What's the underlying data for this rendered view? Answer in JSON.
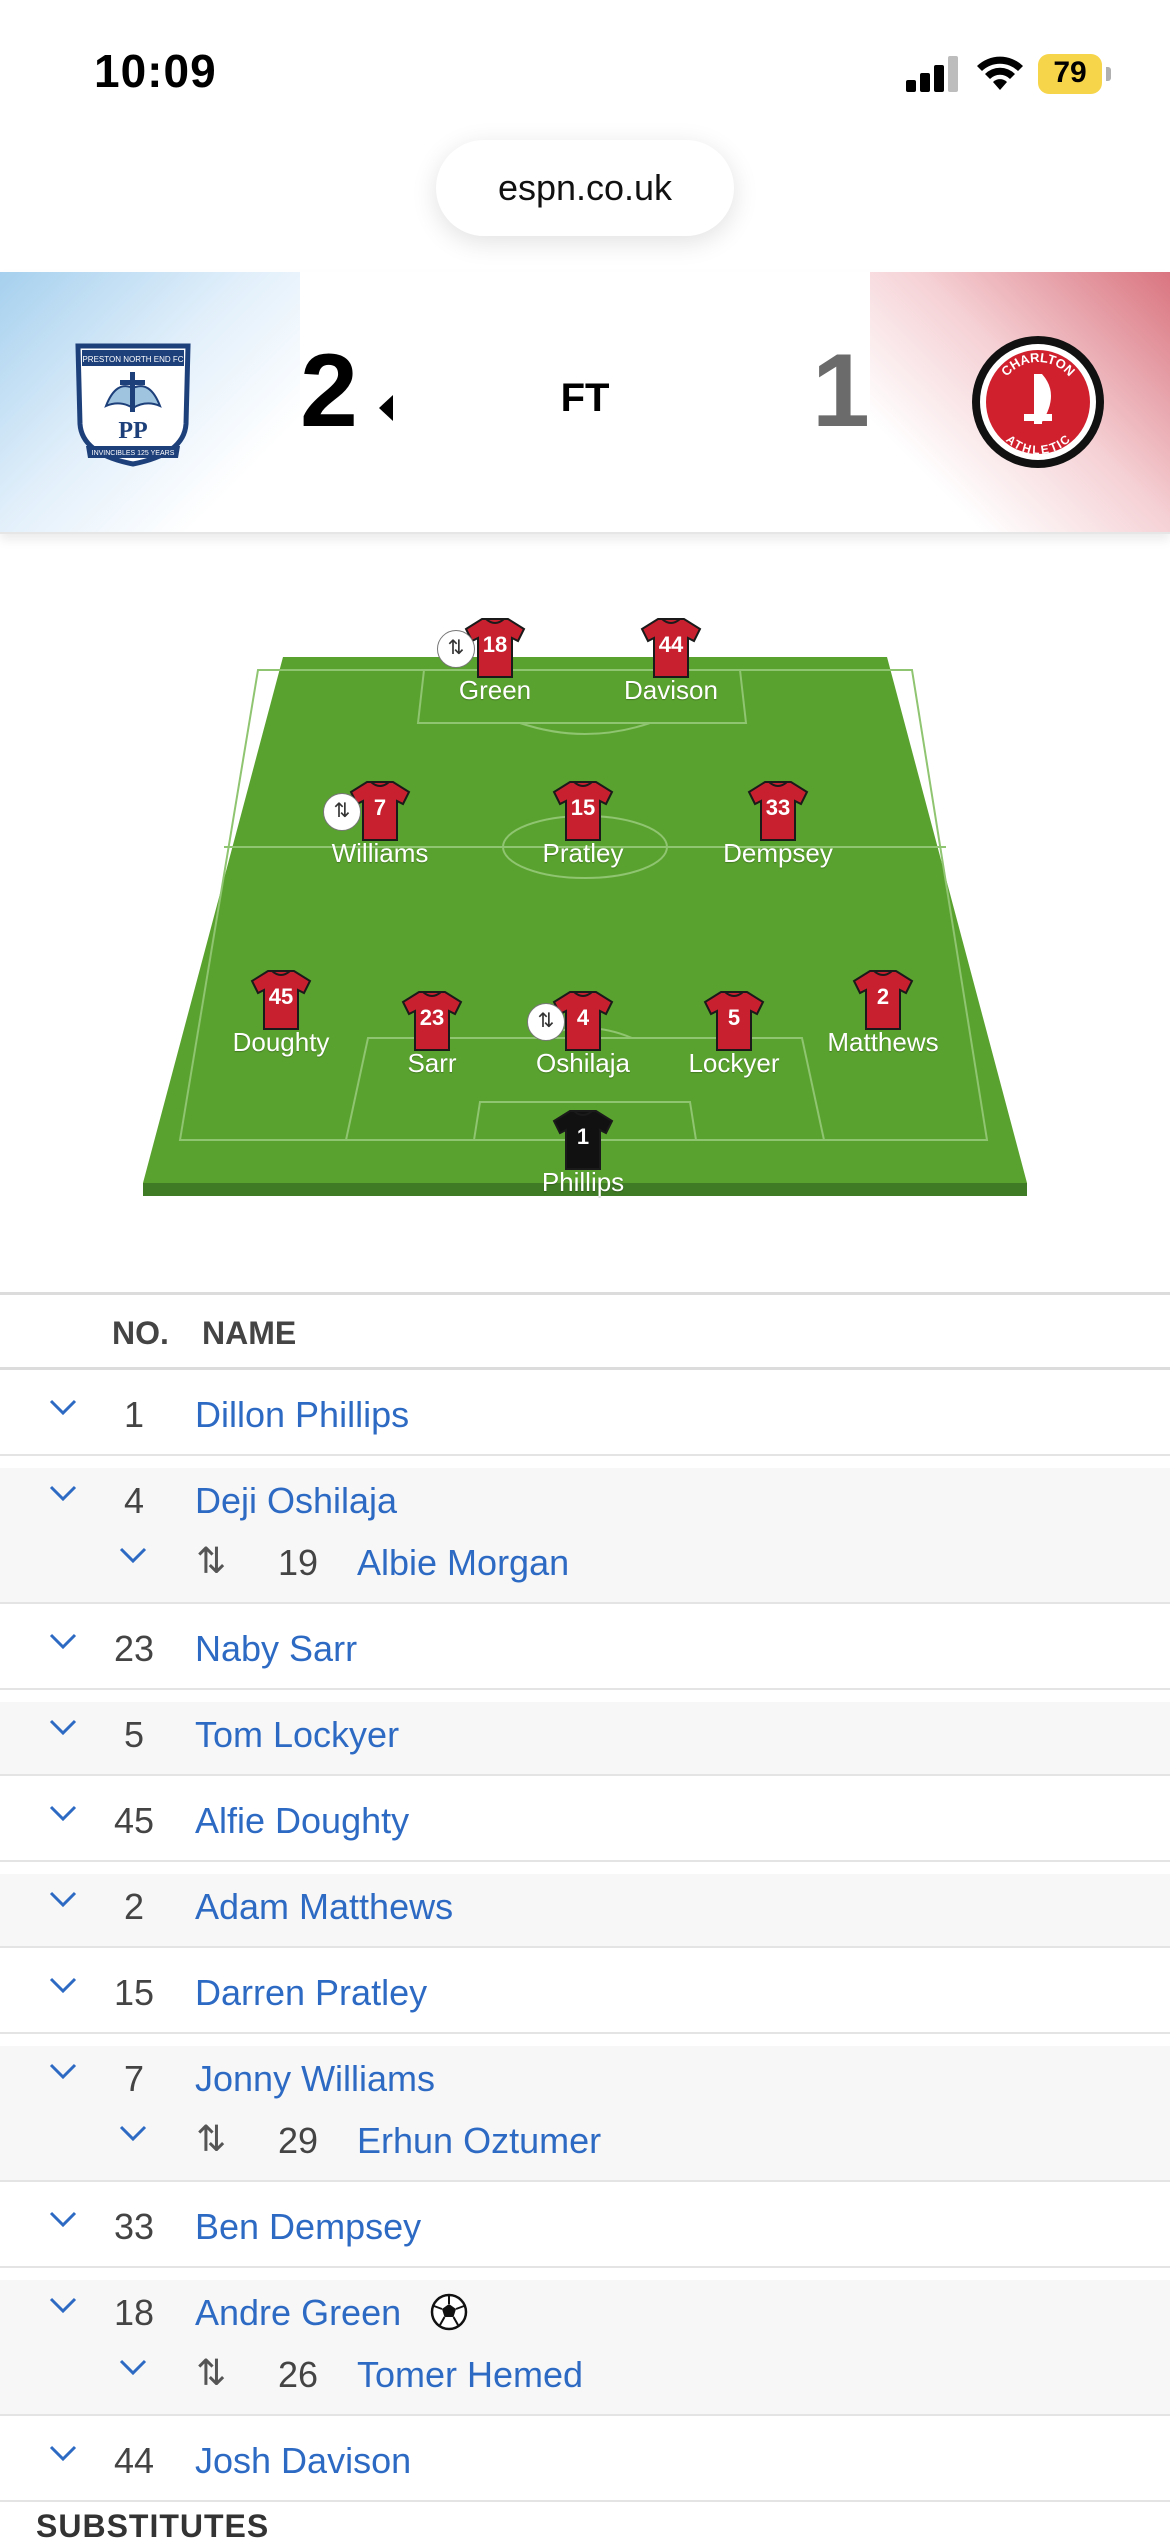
{
  "status_bar": {
    "time": "10:09",
    "battery": "79",
    "signal_icon": "cellular-signal-icon",
    "wifi_icon": "wifi-icon"
  },
  "browser": {
    "url": "espn.co.uk"
  },
  "match": {
    "home_score": "2",
    "away_score": "1",
    "status": "FT",
    "home_crest_icon": "preston-north-end-crest",
    "away_crest_icon": "charlton-athletic-crest",
    "home_crest_top_text": "PRESTON NORTH END FC",
    "home_crest_initials": "PP",
    "home_crest_bottom_text": "INVINCIBLES 125 YEARS",
    "away_crest_top_text": "CHARLTON",
    "away_crest_bottom_text": "ATHLETIC",
    "colors": {
      "home_accent": "#8ec3e6",
      "away_accent": "#c8202f"
    }
  },
  "formation": {
    "shirt_color": "#c8202f",
    "goalkeeper_shirt_color": "#111111",
    "pitch_color": "#5aa22f",
    "players": [
      {
        "number": "18",
        "name": "Green",
        "sub": true
      },
      {
        "number": "44",
        "name": "Davison",
        "sub": false
      },
      {
        "number": "7",
        "name": "Williams",
        "sub": true
      },
      {
        "number": "15",
        "name": "Pratley",
        "sub": false
      },
      {
        "number": "33",
        "name": "Dempsey",
        "sub": false
      },
      {
        "number": "45",
        "name": "Doughty",
        "sub": false
      },
      {
        "number": "23",
        "name": "Sarr",
        "sub": false
      },
      {
        "number": "4",
        "name": "Oshilaja",
        "sub": true
      },
      {
        "number": "5",
        "name": "Lockyer",
        "sub": false
      },
      {
        "number": "2",
        "name": "Matthews",
        "sub": false
      },
      {
        "number": "1",
        "name": "Phillips",
        "sub": false,
        "goalkeeper": true
      }
    ]
  },
  "lineup_table": {
    "headers": {
      "no": "NO.",
      "name": "NAME"
    },
    "rows": [
      {
        "number": "1",
        "name": "Dillon Phillips"
      },
      {
        "number": "4",
        "name": "Deji Oshilaja",
        "sub": {
          "number": "19",
          "name": "Albie Morgan"
        }
      },
      {
        "number": "23",
        "name": "Naby Sarr"
      },
      {
        "number": "5",
        "name": "Tom Lockyer"
      },
      {
        "number": "45",
        "name": "Alfie Doughty"
      },
      {
        "number": "2",
        "name": "Adam Matthews"
      },
      {
        "number": "15",
        "name": "Darren Pratley"
      },
      {
        "number": "7",
        "name": "Jonny Williams",
        "sub": {
          "number": "29",
          "name": "Erhun Oztumer"
        }
      },
      {
        "number": "33",
        "name": "Ben Dempsey"
      },
      {
        "number": "18",
        "name": "Andre Green",
        "goal": true,
        "sub": {
          "number": "26",
          "name": "Tomer Hemed"
        }
      },
      {
        "number": "44",
        "name": "Josh Davison"
      }
    ],
    "substitutes_header": "SUBSTITUTES"
  }
}
